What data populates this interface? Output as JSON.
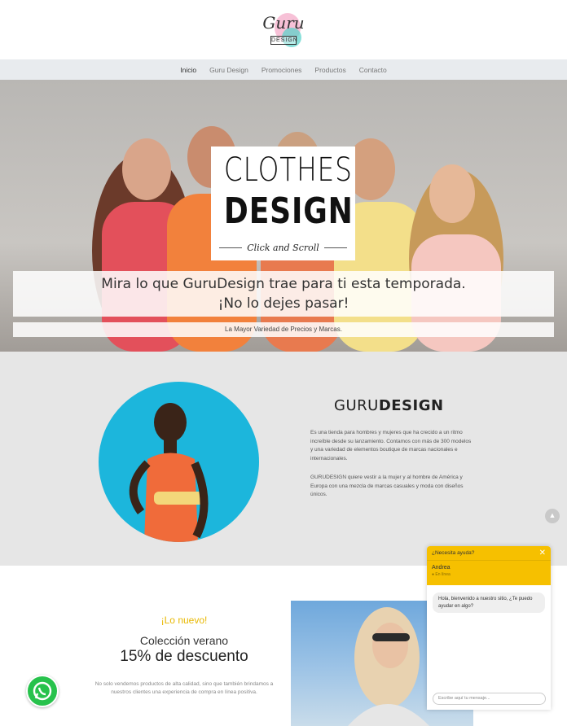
{
  "header": {
    "logo": {
      "main": "Guru",
      "sub": "DESIGN"
    }
  },
  "nav": {
    "items": [
      "Inicio",
      "Guru Design",
      "Promociones",
      "Productos",
      "Contacto"
    ],
    "active": "Inicio"
  },
  "hero": {
    "badge_line1": "CLOTHES",
    "badge_line2": "DESIGN",
    "badge_tagline": "Click and Scroll",
    "message_line1": "Mira lo que GuruDesign trae para ti esta temporada.",
    "message_line2": "¡No lo dejes pasar!",
    "bar_text": "La Mayor Variedad de Precios y Marcas."
  },
  "about": {
    "title_light": "GURU",
    "title_bold": "DESIGN",
    "paragraph1": "Es una tienda para hombres y mujeres que ha crecido a un ritmo increíble desde su lanzamiento. Contamos con más de 300 modelos y una variedad de elementos boutique de marcas nacionales e internacionales.",
    "paragraph2": "GURUDESIGN quiere vestir a la mujer y al hombre de América y Europa con una mezcla de marcas casuales y moda con diseños únicos."
  },
  "promo": {
    "new_label": "¡Lo nuevo!",
    "heading": "Colección verano",
    "discount": "15% de descuento",
    "text": "No solo vendemos productos de alta calidad, sino que también brindamos a nuestros clientes una experiencia de compra en línea positiva."
  },
  "chat": {
    "header": "¿Necesita ayuda?",
    "agent_name": "Andrea",
    "agent_status": "● En línea",
    "message": "Hola, bienvenido a nuestro sitio, ¿Te puedo ayudar en algo?",
    "input_placeholder": "Escribe aquí tu mensaje..."
  },
  "colors": {
    "accent": "#f6c000",
    "nav_bg": "#e8ebee",
    "about_bg": "#e6e6e6",
    "circle": "#1cb6dc",
    "whatsapp": "#27c24c"
  },
  "icons": [
    "close-icon",
    "scroll-top-icon",
    "whatsapp-icon"
  ]
}
